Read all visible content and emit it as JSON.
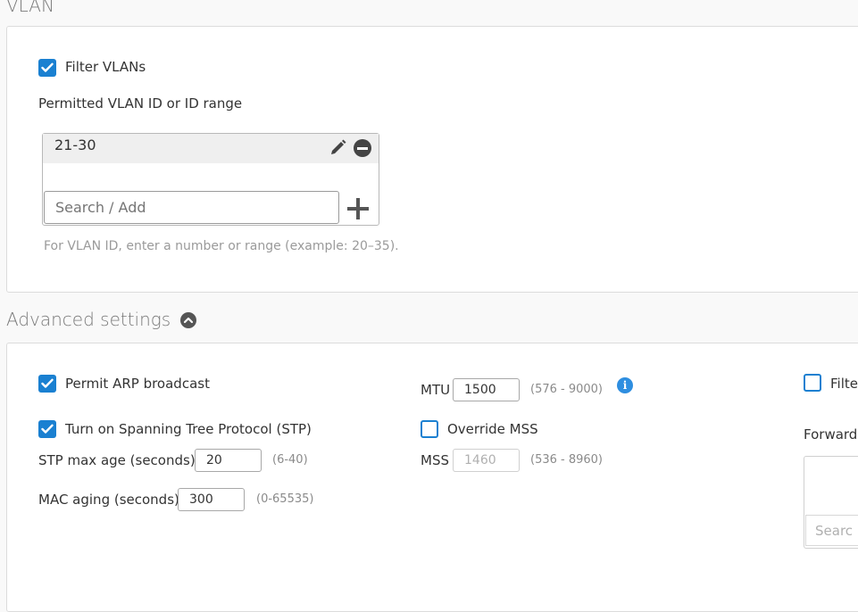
{
  "vlan": {
    "title": "VLAN",
    "filter_vlans_label": "Filter VLANs",
    "filter_vlans_checked": true,
    "permitted_label": "Permitted VLAN ID or ID range",
    "items": [
      "21-30"
    ],
    "search_placeholder": "Search / Add",
    "hint": "For VLAN ID, enter a number or range (example: 20–35)."
  },
  "advanced": {
    "title": "Advanced settings",
    "permit_arp_label": "Permit ARP broadcast",
    "permit_arp_checked": true,
    "stp_label": "Turn on Spanning Tree Protocol (STP)",
    "stp_checked": true,
    "stp_max_age_label": "STP max age (seconds)",
    "stp_max_age_value": "20",
    "stp_max_age_range": "(6-40)",
    "mac_aging_label": "MAC aging (seconds)",
    "mac_aging_value": "300",
    "mac_aging_range": "(0-65535)",
    "mtu_label": "MTU",
    "mtu_value": "1500",
    "mtu_range": "(576 - 9000)",
    "override_mss_label": "Override MSS",
    "override_mss_checked": false,
    "mss_label": "MSS",
    "mss_value": "1460",
    "mss_range": "(536 - 8960)",
    "filter_label_partial": "Filte",
    "forward_label_partial": "Forward",
    "search_partial": "Searc"
  },
  "colors": {
    "accent": "#1a80d1",
    "info": "#2e8ee0"
  }
}
